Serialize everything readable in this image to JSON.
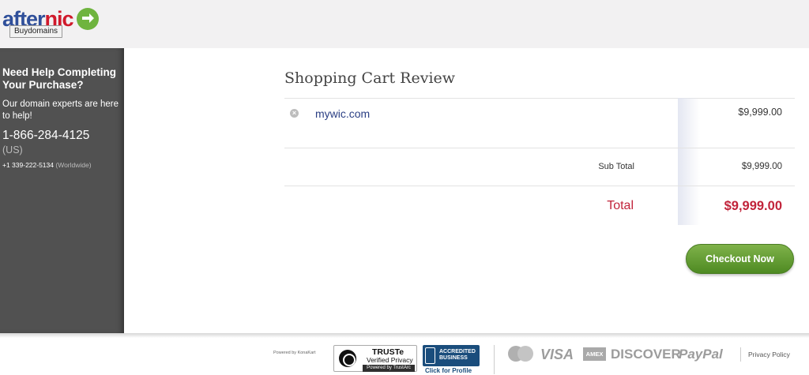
{
  "header": {
    "logo_part1": "after",
    "logo_part2": "nic",
    "logo_sublabel": "Buydomains"
  },
  "sidebar": {
    "title": "Need Help Completing Your Purchase?",
    "text": "Our domain experts are here to help!",
    "phone_us": "1-866-284-4125",
    "phone_us_label": "(US)",
    "phone_intl": "+1 339-222-5134",
    "phone_intl_label": "(Worldwide)"
  },
  "cart": {
    "title": "Shopping Cart Review",
    "items": [
      {
        "name": "mywic.com",
        "price": "$9,999.00"
      }
    ],
    "subtotal_label": "Sub Total",
    "subtotal_value": "$9,999.00",
    "total_label": "Total",
    "total_value": "$9,999.00",
    "checkout_label": "Checkout Now"
  },
  "footer": {
    "powered_by": "Powered by KonaKart",
    "truste_title": "TRUSTe",
    "truste_sub": "Verified Privacy",
    "truste_powered": "Powered by TrustArc",
    "bbb_text": "ACCREDITED BUSINESS",
    "bbb_click": "Click for Profile",
    "payments": [
      "MasterCard",
      "VISA",
      "AMEX",
      "DISCOVER",
      "PayPal"
    ],
    "privacy_link": "Privacy Policy"
  },
  "colors": {
    "brand_blue": "#2f4f9a",
    "brand_red": "#d0192b",
    "total_red": "#c1233a",
    "checkout_green": "#5e9a30",
    "sidebar_bg": "#515151"
  }
}
